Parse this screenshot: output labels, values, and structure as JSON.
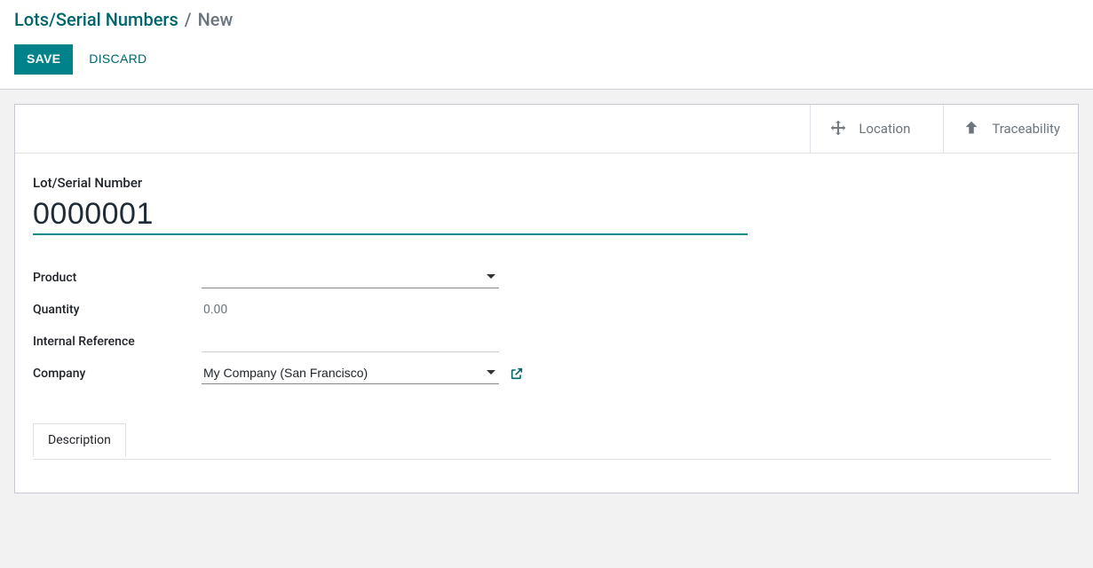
{
  "breadcrumb": {
    "root": "Lots/Serial Numbers",
    "sep": "/",
    "current": "New"
  },
  "controls": {
    "save": "SAVE",
    "discard": "DISCARD"
  },
  "stat_buttons": {
    "location": "Location",
    "traceability": "Traceability"
  },
  "form": {
    "title_label": "Lot/Serial Number",
    "title_value": "0000001",
    "product_label": "Product",
    "product_value": "",
    "quantity_label": "Quantity",
    "quantity_value": "0.00",
    "internal_ref_label": "Internal Reference",
    "internal_ref_value": "",
    "company_label": "Company",
    "company_value": "My Company (San Francisco)"
  },
  "tabs": {
    "description": "Description"
  }
}
